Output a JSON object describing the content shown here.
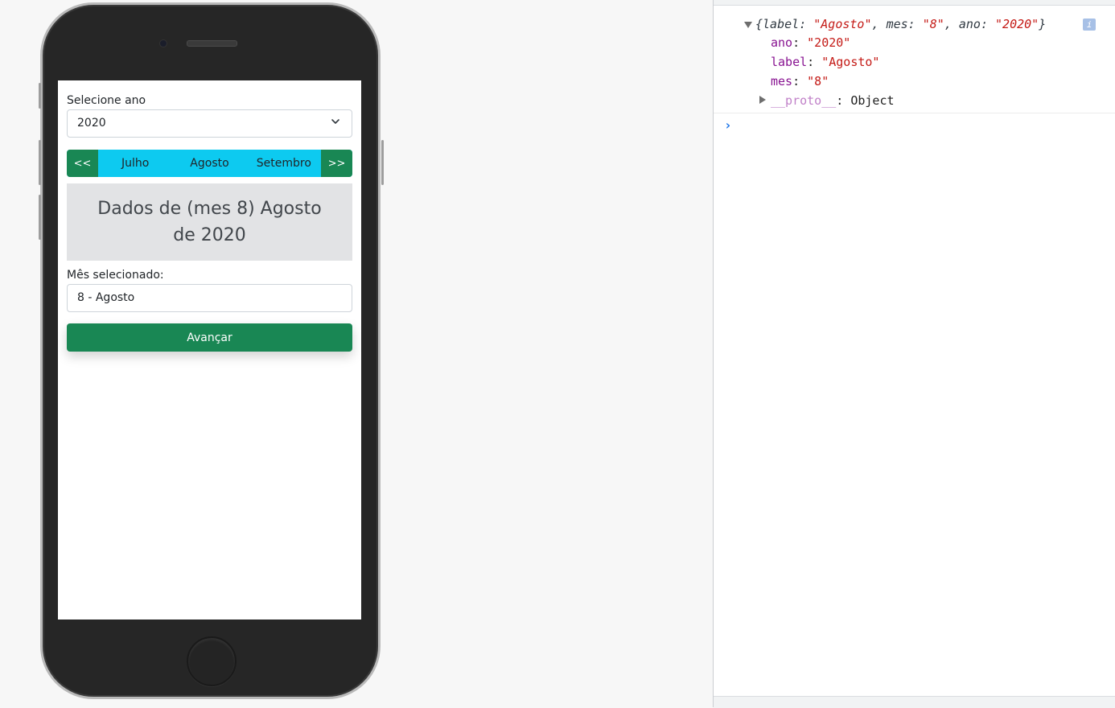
{
  "phone_form": {
    "year_label": "Selecione ano",
    "year_select": {
      "selected": "2020"
    },
    "month_nav": {
      "prev_label": "<<",
      "next_label": ">>",
      "months": [
        "Julho",
        "Agosto",
        "Setembro"
      ]
    },
    "info_panel": {
      "text": "Dados de (mes 8) Agosto de 2020"
    },
    "selected_month_label": "Mês selecionado:",
    "selected_month_value": "8 - Agosto",
    "advance_button": "Avançar"
  },
  "console": {
    "summary": {
      "open": "{",
      "k1": "label",
      "v1": "\"Agosto\"",
      "k2": "mes",
      "v2": "\"8\"",
      "k3": "ano",
      "v3": "\"2020\"",
      "close": "}"
    },
    "info_badge": "i",
    "properties": [
      {
        "key": "ano",
        "value": "\"2020\""
      },
      {
        "key": "label",
        "value": "\"Agosto\""
      },
      {
        "key": "mes",
        "value": "\"8\""
      }
    ],
    "proto": {
      "key": "__proto__",
      "value": "Object"
    },
    "prompt": "›"
  },
  "colors": {
    "success": "#198754",
    "info": "#0dcaf0",
    "panel_bg": "#e2e3e5",
    "console_key": "#881391",
    "console_string": "#c41a16"
  }
}
